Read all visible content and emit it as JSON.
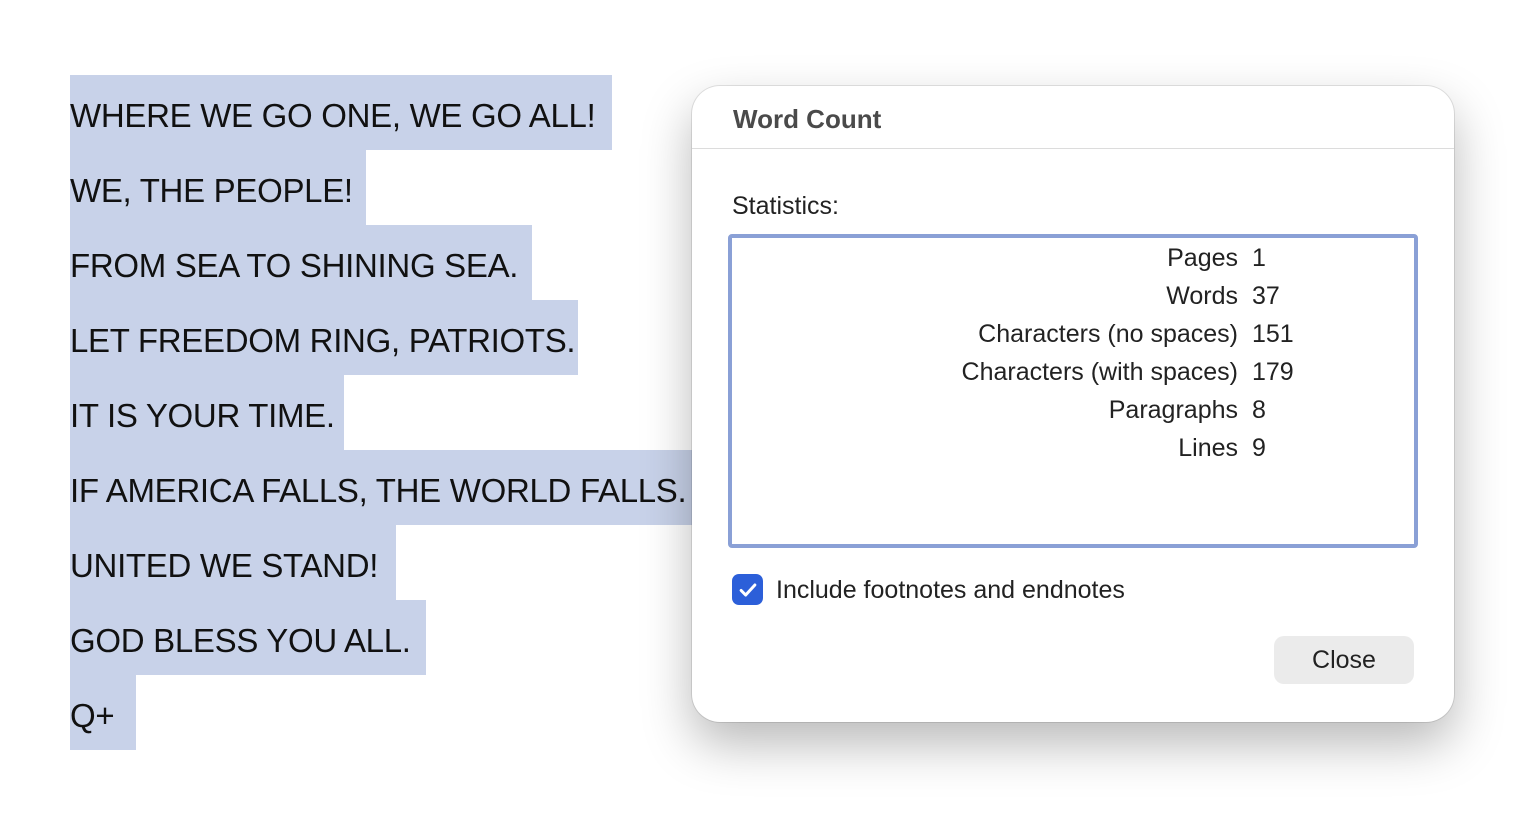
{
  "document": {
    "lines": [
      {
        "text": "WHERE WE GO ONE, WE GO ALL!"
      },
      {
        "text": "WE, THE PEOPLE!"
      },
      {
        "text": "FROM SEA TO SHINING SEA."
      },
      {
        "text": "LET FREEDOM RING, PATRIOTS."
      },
      {
        "text": "IT IS YOUR TIME."
      },
      {
        "text": "IF AMERICA FALLS, THE WORLD FALLS."
      },
      {
        "text": "UNITED WE STAND!"
      },
      {
        "text": "GOD BLESS YOU ALL."
      },
      {
        "text": "Q+"
      }
    ],
    "selection_color": "#c8d2e9"
  },
  "dialog": {
    "title": "Word Count",
    "statistics_label": "Statistics:",
    "stats": [
      {
        "name": "Pages",
        "value": "1"
      },
      {
        "name": "Words",
        "value": "37"
      },
      {
        "name": "Characters (no spaces)",
        "value": "151"
      },
      {
        "name": "Characters (with spaces)",
        "value": "179"
      },
      {
        "name": "Paragraphs",
        "value": "8"
      },
      {
        "name": "Lines",
        "value": "9"
      }
    ],
    "include_footnotes_label": "Include footnotes and endnotes",
    "include_footnotes_checked": true,
    "close_label": "Close",
    "accent_color": "#2c5fd9",
    "focus_border_color": "#8aa0d6"
  }
}
